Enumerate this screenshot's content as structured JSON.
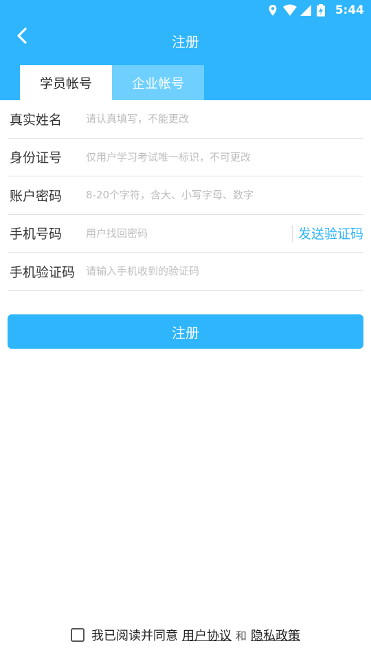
{
  "status_bar": {
    "time": "5:44",
    "icons": [
      "location-icon",
      "wifi-icon",
      "signal-icon",
      "battery-icon"
    ]
  },
  "header": {
    "title": "注册",
    "back_icon": "chevron-left-icon",
    "bg_color": "#2eb5fb"
  },
  "tabs": [
    {
      "label": "学员帐号",
      "active": true
    },
    {
      "label": "企业帐号",
      "active": false
    }
  ],
  "form": {
    "fields": [
      {
        "label": "真实姓名",
        "placeholder": "请认真填写，不能更改",
        "value": ""
      },
      {
        "label": "身份证号",
        "placeholder": "仅用户学习考试唯一标识，不可更改",
        "value": ""
      },
      {
        "label": "账户密码",
        "placeholder": "8-20个字符，含大、小写字母、数字",
        "value": ""
      },
      {
        "label": "手机号码",
        "placeholder": "用户找回密码",
        "value": ""
      },
      {
        "label": "手机验证码",
        "placeholder": "请输入手机收到的验证码",
        "value": ""
      }
    ],
    "send_code_label": "发送验证码"
  },
  "submit_label": "注册",
  "agreement": {
    "text": "我已阅读并同意",
    "user_agreement": "用户协议",
    "and": "和",
    "privacy_policy": "隐私政策",
    "checked": false
  },
  "colors": {
    "accent": "#2eb5fb",
    "tab_inactive": "#6fd0ff"
  }
}
